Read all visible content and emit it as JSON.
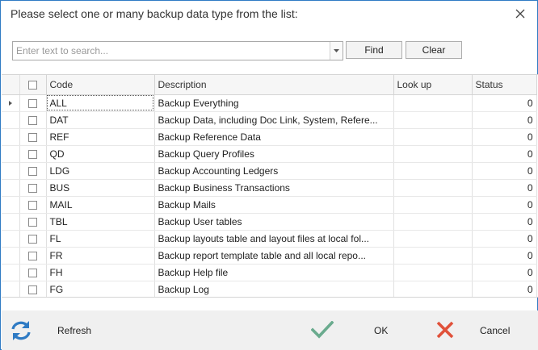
{
  "dialog": {
    "title": "Please select one or many backup data type from the list:"
  },
  "search": {
    "placeholder": "Enter text to search...",
    "value": "",
    "find_label": "Find",
    "clear_label": "Clear"
  },
  "grid": {
    "columns": [
      "Code",
      "Description",
      "Look up",
      "Status"
    ],
    "rows": [
      {
        "code": "ALL",
        "description": "Backup Everything",
        "lookup": "",
        "status": "0"
      },
      {
        "code": "DAT",
        "description": "Backup Data, including Doc Link, System, Refere...",
        "lookup": "",
        "status": "0"
      },
      {
        "code": "REF",
        "description": "Backup Reference Data",
        "lookup": "",
        "status": "0"
      },
      {
        "code": "QD",
        "description": "Backup Query Profiles",
        "lookup": "",
        "status": "0"
      },
      {
        "code": "LDG",
        "description": "Backup Accounting Ledgers",
        "lookup": "",
        "status": "0"
      },
      {
        "code": "BUS",
        "description": "Backup Business Transactions",
        "lookup": "",
        "status": "0"
      },
      {
        "code": "MAIL",
        "description": "Backup Mails",
        "lookup": "",
        "status": "0"
      },
      {
        "code": "TBL",
        "description": "Backup User tables",
        "lookup": "",
        "status": "0"
      },
      {
        "code": "FL",
        "description": "Backup layouts table and layout files at local fol...",
        "lookup": "",
        "status": "0"
      },
      {
        "code": "FR",
        "description": "Backup report template table and all local repo...",
        "lookup": "",
        "status": "0"
      },
      {
        "code": "FH",
        "description": "Backup Help file",
        "lookup": "",
        "status": "0"
      },
      {
        "code": "FG",
        "description": "Backup Log",
        "lookup": "",
        "status": "0"
      }
    ]
  },
  "footer": {
    "refresh_label": "Refresh",
    "ok_label": "OK",
    "cancel_label": "Cancel"
  },
  "icons": {
    "close": "close-icon",
    "dropdown": "chevron-down-icon",
    "refresh": "refresh-icon",
    "ok": "checkmark-icon",
    "cancel": "cross-icon"
  },
  "colors": {
    "border": "#2f7bc4",
    "refresh_icon": "#2f7bc4",
    "ok_icon": "#6aab8e",
    "cancel_icon": "#e0513a"
  }
}
